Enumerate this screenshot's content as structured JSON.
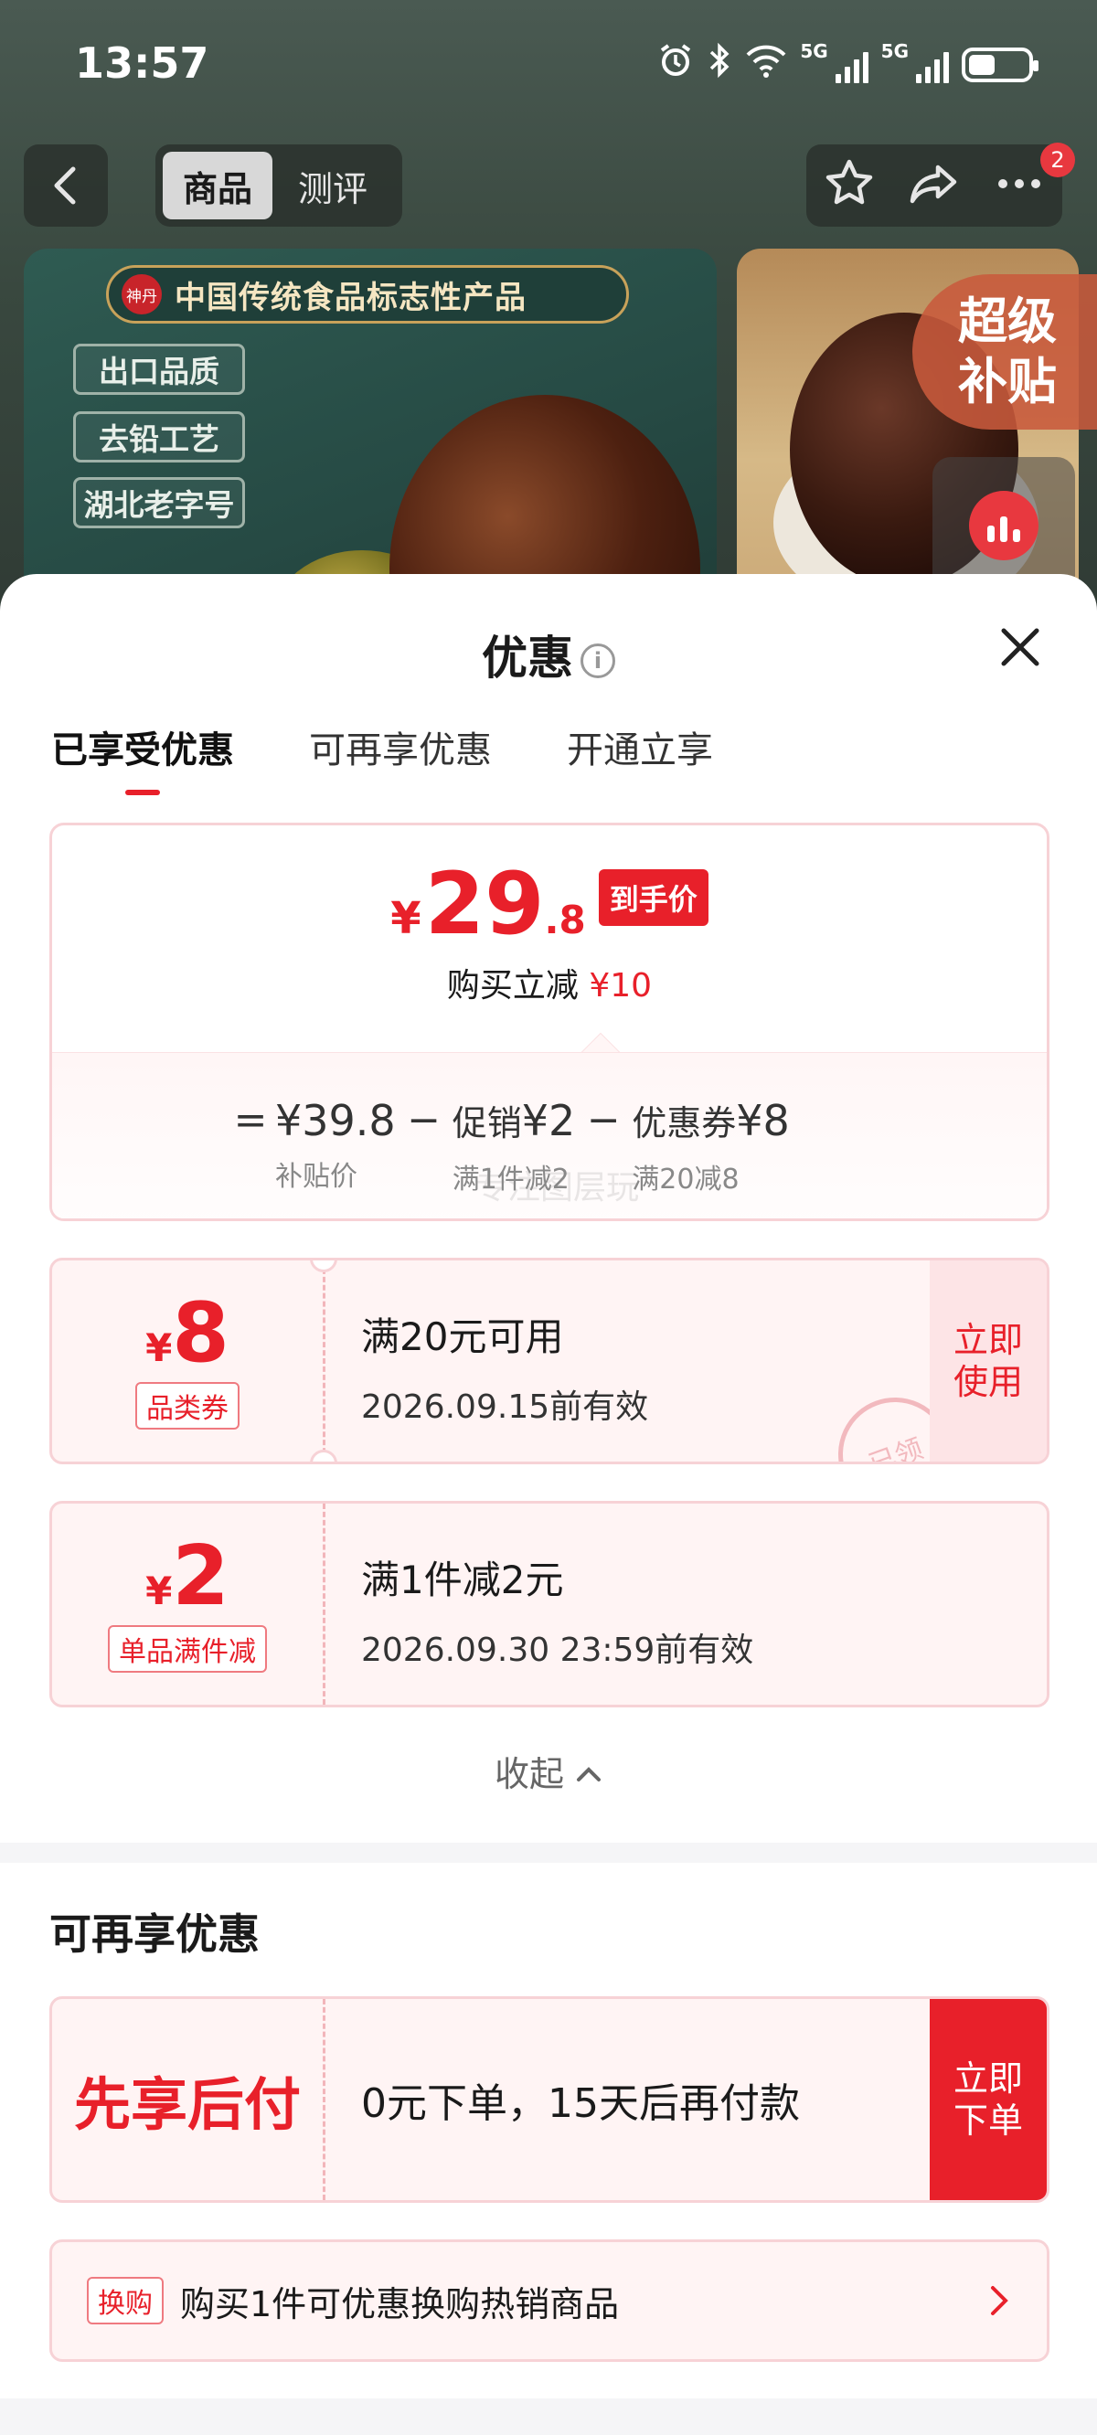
{
  "status_bar": {
    "time": "13:57",
    "network": "5G"
  },
  "nav": {
    "tab_product": "商品",
    "tab_review": "测评",
    "badge_count": "2"
  },
  "hero": {
    "brand_seal": "神丹",
    "banner": "中国传统食品标志性产品",
    "tags": [
      "出口品质",
      "去铅工艺",
      "湖北老字号"
    ],
    "super_badge": [
      "超级",
      "补贴"
    ]
  },
  "sheet": {
    "title": "优惠",
    "tabs": [
      "已享受优惠",
      "可再享优惠",
      "开通立享"
    ],
    "summary": {
      "currency": "¥",
      "price_int": "29",
      "price_dec": ".8",
      "price_tag": "到手价",
      "reduce_label": "购买立减",
      "reduce_value": "¥10",
      "formula": {
        "eq": "=",
        "minus": "−",
        "items": [
          {
            "label": "",
            "value": "¥39.8",
            "sub": "补贴价"
          },
          {
            "label": "促销",
            "value": "¥2",
            "sub": "满1件减2"
          },
          {
            "label": "优惠券",
            "value": "¥8",
            "sub": "满20减8"
          }
        ]
      },
      "watermark": "专注图层玩"
    },
    "coupons": [
      {
        "currency": "¥",
        "amount": "8",
        "type": "品类券",
        "title": "满20元可用",
        "date": "2026.09.15前有效",
        "action": [
          "立即",
          "使用"
        ],
        "stamp": "已领"
      },
      {
        "currency": "¥",
        "amount": "2",
        "type": "单品满件减",
        "title": "满1件减2元",
        "date": "2026.09.30 23:59前有效"
      }
    ],
    "collapse_label": "收起",
    "more_section": {
      "title": "可再享优惠",
      "paylater": {
        "left": "先享后付",
        "text": "0元下单，15天后再付款",
        "action": [
          "立即",
          "下单"
        ]
      },
      "tradein": {
        "tag": "换购",
        "text": "购买1件可优惠换购热销商品"
      }
    }
  },
  "colors": {
    "accent": "#e8202a",
    "border": "#f7d2d6",
    "coupon_bg": "#fff4f4"
  }
}
